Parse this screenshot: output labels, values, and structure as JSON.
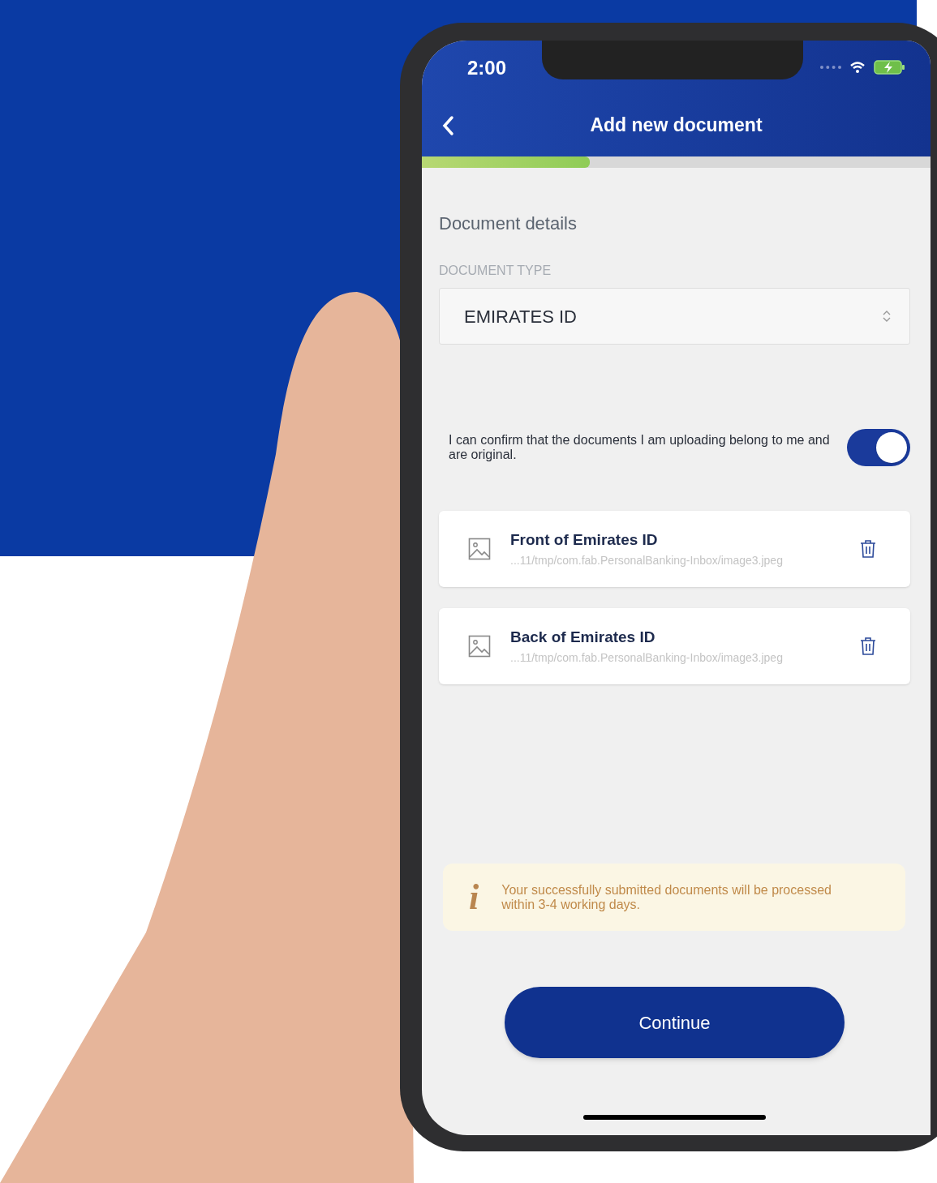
{
  "status_bar": {
    "time": "2:00"
  },
  "header": {
    "title": "Add new document",
    "progress": {
      "level": 0.33
    }
  },
  "section_title": "Document details",
  "document_type": {
    "label": "DOCUMENT TYPE",
    "value": "EMIRATES ID"
  },
  "confirmation": {
    "text": "I can confirm that the documents I am uploading belong to me and are original.",
    "on": true
  },
  "files": [
    {
      "title": "Front of Emirates ID",
      "path": "...11/tmp/com.fab.PersonalBanking-Inbox/image3.jpeg"
    },
    {
      "title": "Back of Emirates ID",
      "path": "...11/tmp/com.fab.PersonalBanking-Inbox/image3.jpeg"
    }
  ],
  "notice": {
    "icon": "i",
    "text": "Your successfully submitted documents will be processed within 3-4 working days."
  },
  "continue_button": "Continue"
}
